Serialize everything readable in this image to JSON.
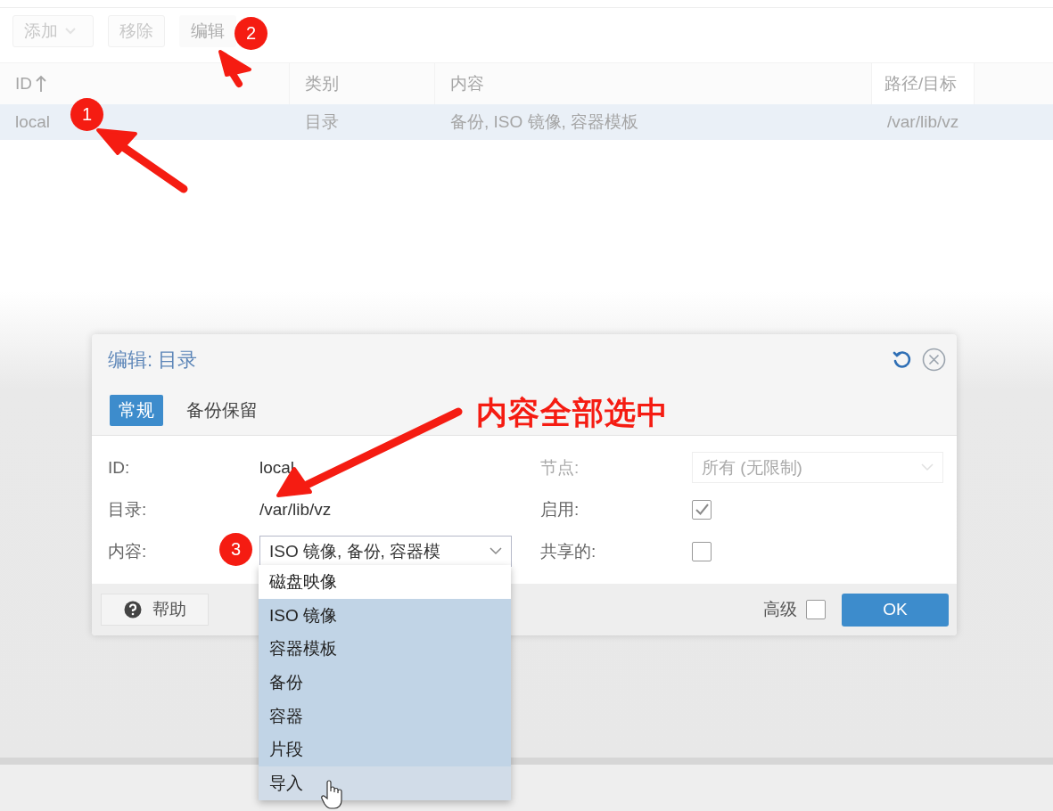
{
  "toolbar": {
    "buttons": [
      {
        "label": "添加",
        "kind": "menu"
      },
      {
        "label": "移除",
        "kind": "plain"
      },
      {
        "label": "编辑",
        "kind": "plain"
      }
    ]
  },
  "table": {
    "columns": [
      {
        "label": "ID",
        "sorted": true
      },
      {
        "label": "类别",
        "sorted": false
      },
      {
        "label": "内容",
        "sorted": false
      },
      {
        "label": "路径/目标",
        "sorted": false
      }
    ],
    "rows": [
      {
        "cells": [
          "local",
          "目录",
          "备份, ISO 镜像, 容器模板",
          "/var/lib/vz"
        ],
        "selected": true
      }
    ]
  },
  "dialog": {
    "title": "编辑: 目录",
    "tabs": [
      {
        "label": "常规",
        "selected": true
      },
      {
        "label": "备份保留",
        "selected": false
      }
    ],
    "left_fields": [
      {
        "kind": "text",
        "label": "ID:",
        "value": "local"
      },
      {
        "kind": "text",
        "label": "目录:",
        "value": "/var/lib/vz"
      },
      {
        "kind": "combo",
        "label": "内容:",
        "value": "ISO 镜像, 备份, 容器模"
      }
    ],
    "right_fields": [
      {
        "kind": "combo",
        "label": "节点:",
        "value": "所有 (无限制)",
        "disabled": true
      },
      {
        "kind": "checkbox",
        "label": "启用:",
        "checked": true,
        "disabled": false
      },
      {
        "kind": "checkbox",
        "label": "共享的:",
        "checked": false,
        "disabled": false
      }
    ],
    "help_button": "帮助",
    "advanced": {
      "label": "高级",
      "checked": false
    },
    "ok_button": "OK"
  },
  "dropdown": {
    "options": [
      {
        "label": "磁盘映像",
        "selected": false,
        "hovered": false
      },
      {
        "label": "ISO 镜像",
        "selected": true,
        "hovered": false
      },
      {
        "label": "容器模板",
        "selected": true,
        "hovered": false
      },
      {
        "label": "备份",
        "selected": true,
        "hovered": false
      },
      {
        "label": "容器",
        "selected": true,
        "hovered": false
      },
      {
        "label": "片段",
        "selected": true,
        "hovered": false
      },
      {
        "label": "导入",
        "selected": true,
        "hovered": true
      }
    ]
  },
  "annotations": {
    "steps": [
      "1",
      "2",
      "3"
    ],
    "caption": "内容全部选中"
  }
}
